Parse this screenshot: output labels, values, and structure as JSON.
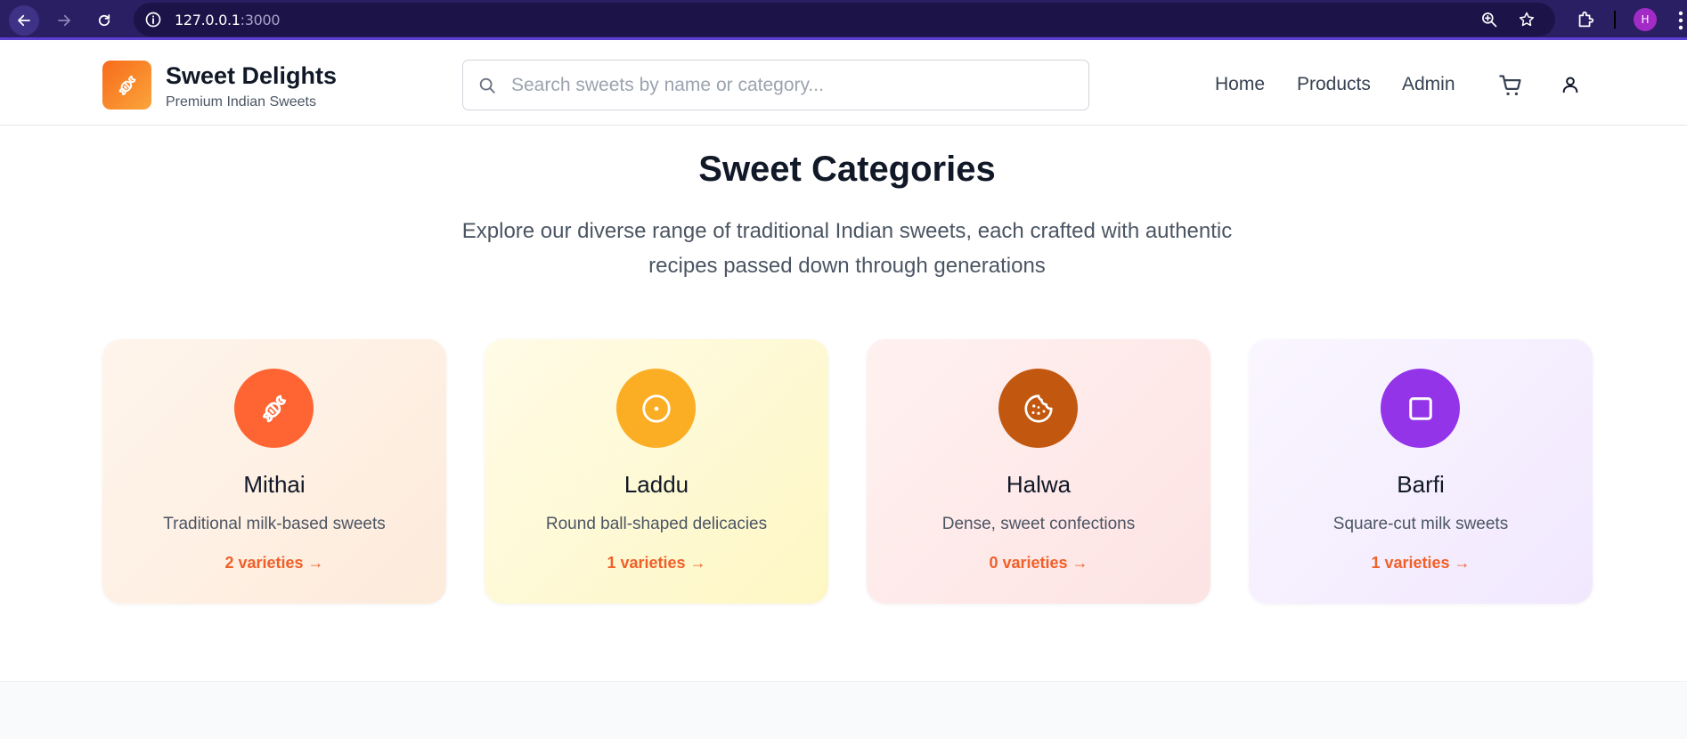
{
  "browser": {
    "url_host": "127.0.0.1",
    "url_port": ":3000",
    "profile_initial": "H",
    "icons": [
      "back-arrow-icon",
      "forward-arrow-icon",
      "reload-icon",
      "site-info-icon",
      "zoom-icon",
      "star-icon",
      "extensions-icon",
      "menu-icon"
    ]
  },
  "header": {
    "brand_name": "Sweet Delights",
    "brand_tagline": "Premium Indian Sweets",
    "logo_icon": "candy-icon",
    "search_placeholder": "Search sweets by name or category...",
    "nav": {
      "home": "Home",
      "products": "Products",
      "admin": "Admin"
    },
    "cart_icon": "cart-icon",
    "user_icon": "user-icon"
  },
  "main": {
    "title": "Sweet Categories",
    "description": "Explore our diverse range of traditional Indian sweets, each crafted with authentic recipes passed down through generations",
    "categories": [
      {
        "name": "Mithai",
        "description": "Traditional milk-based sweets",
        "count_label": "2 varieties →",
        "icon": "candy-icon",
        "color": "#ff6433"
      },
      {
        "name": "Laddu",
        "description": "Round ball-shaped delicacies",
        "count_label": "1 varieties →",
        "icon": "circle-dot-icon",
        "color": "#fbad23"
      },
      {
        "name": "Halwa",
        "description": "Dense, sweet confections",
        "count_label": "0 varieties →",
        "icon": "cookie-icon",
        "color": "#c2580f"
      },
      {
        "name": "Barfi",
        "description": "Square-cut milk sweets",
        "count_label": "1 varieties →",
        "icon": "square-icon",
        "color": "#9334e9"
      }
    ]
  }
}
